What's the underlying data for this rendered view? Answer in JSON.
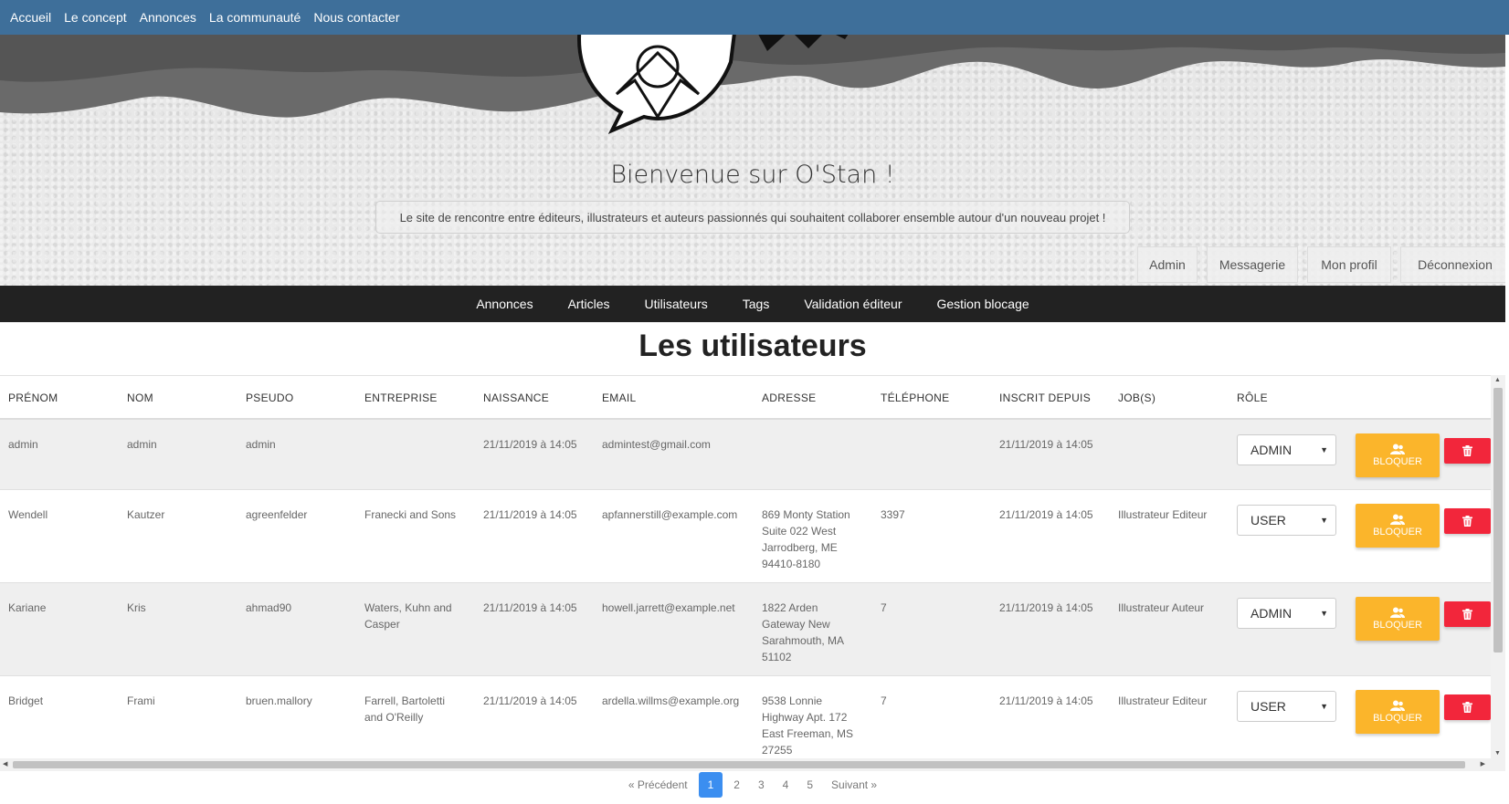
{
  "topnav": {
    "items": [
      "Accueil",
      "Le concept",
      "Annonces",
      "La communauté",
      "Nous contacter"
    ]
  },
  "hero": {
    "title": "Bienvenue sur O'Stan !",
    "subtitle": "Le site de rencontre entre éditeurs, illustrateurs et auteurs passionnés qui souhaitent collaborer ensemble autour d'un nouveau projet !",
    "buttons": [
      "Admin",
      "Messagerie",
      "Mon profil",
      "Déconnexion"
    ]
  },
  "adminnav": {
    "items": [
      "Annonces",
      "Articles",
      "Utilisateurs",
      "Tags",
      "Validation éditeur",
      "Gestion blocage"
    ]
  },
  "page": {
    "title": "Les utilisateurs"
  },
  "table": {
    "headers": [
      "PRÉNOM",
      "NOM",
      "PSEUDO",
      "ENTREPRISE",
      "NAISSANCE",
      "EMAIL",
      "ADRESSE",
      "TÉLÉPHONE",
      "INSCRIT DEPUIS",
      "JOB(S)",
      "RÔLE"
    ],
    "block_label": "BLOQUER",
    "rows": [
      {
        "prenom": "admin",
        "nom": "admin",
        "pseudo": "admin",
        "entreprise": "",
        "naissance": "21/11/2019 à 14:05",
        "email": "admintest@gmail.com",
        "adresse": "",
        "telephone": "",
        "inscrit": "21/11/2019 à 14:05",
        "jobs": "",
        "role": "ADMIN"
      },
      {
        "prenom": "Wendell",
        "nom": "Kautzer",
        "pseudo": "agreenfelder",
        "entreprise": "Franecki and Sons",
        "naissance": "21/11/2019 à 14:05",
        "email": "apfannerstill@example.com",
        "adresse": "869 Monty Station\nSuite 022 West\nJarrodberg, ME\n94410-8180",
        "telephone": "3397",
        "inscrit": "21/11/2019 à 14:05",
        "jobs": "Illustrateur Editeur",
        "role": "USER"
      },
      {
        "prenom": "Kariane",
        "nom": "Kris",
        "pseudo": "ahmad90",
        "entreprise": "Waters, Kuhn and\nCasper",
        "naissance": "21/11/2019 à 14:05",
        "email": "howell.jarrett@example.net",
        "adresse": "1822 Arden\nGateway New\nSarahmouth, MA\n51102",
        "telephone": "7",
        "inscrit": "21/11/2019 à 14:05",
        "jobs": "Illustrateur Auteur",
        "role": "ADMIN"
      },
      {
        "prenom": "Bridget",
        "nom": "Frami",
        "pseudo": "bruen.mallory",
        "entreprise": "Farrell, Bartoletti\nand O'Reilly",
        "naissance": "21/11/2019 à 14:05",
        "email": "ardella.willms@example.org",
        "adresse": "9538 Lonnie\nHighway Apt. 172\nEast Freeman, MS\n27255",
        "telephone": "7",
        "inscrit": "21/11/2019 à 14:05",
        "jobs": "Illustrateur Editeur",
        "role": "USER"
      }
    ]
  },
  "pagination": {
    "prev": "« Précédent",
    "pages": [
      "1",
      "2",
      "3",
      "4",
      "5"
    ],
    "current": "1",
    "next": "Suivant »"
  },
  "colors": {
    "topnav_bg": "#3e6f9a",
    "adminnav_bg": "#222222",
    "block_button": "#fbb52b",
    "delete_button": "#f2263b",
    "pager_active": "#3b8ef0"
  },
  "icons": {
    "block": "users-icon",
    "delete": "trash-icon"
  }
}
